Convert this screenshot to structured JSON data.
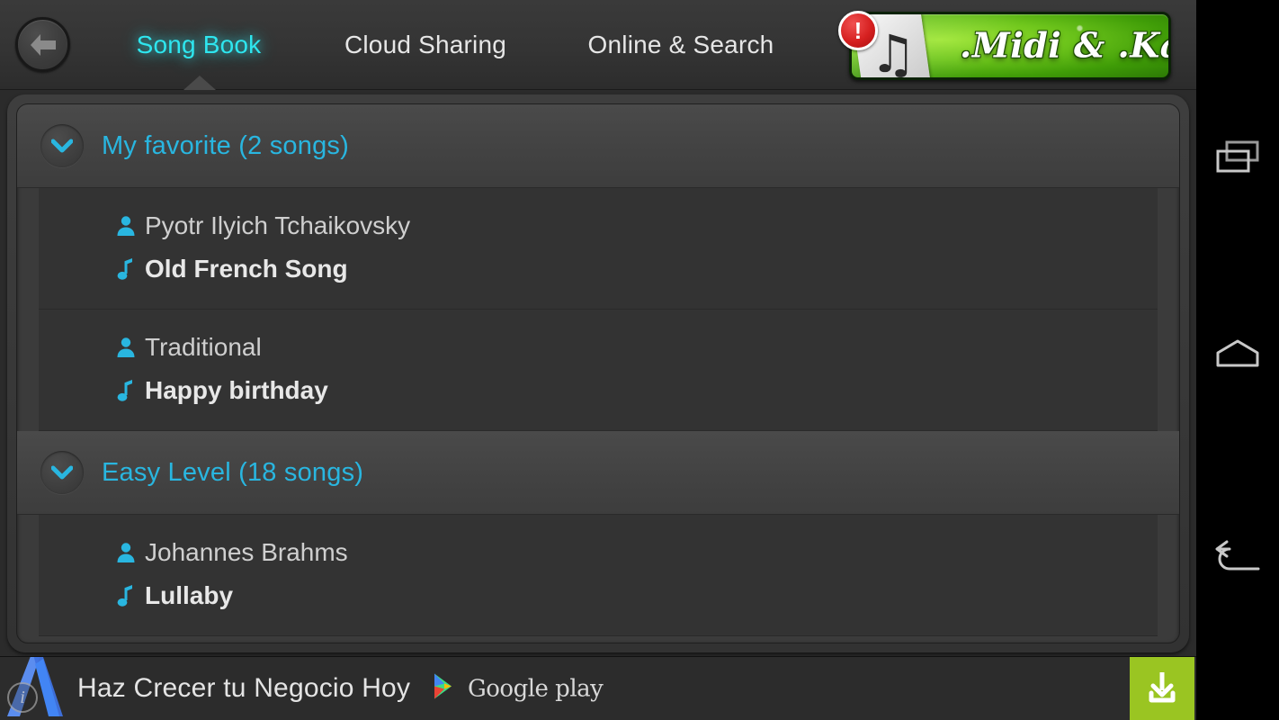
{
  "app": {
    "back_button_icon": "arrow-left-icon",
    "tabs": [
      {
        "label": "Song Book",
        "active": true
      },
      {
        "label": "Cloud Sharing",
        "active": false
      },
      {
        "label": "Online & Search",
        "active": false
      }
    ],
    "brand": {
      "name": ".Midi & .Kar",
      "badge": "!",
      "note_glyph": "♫",
      "colors": {
        "green_light": "#9ee634",
        "green_dark": "#2c7a05",
        "badge_red": "#d62020"
      }
    },
    "accent_color": "#29b6e0",
    "active_tab_color": "#2ee6ef"
  },
  "library": {
    "groups": [
      {
        "title": "My favorite (2 songs)",
        "expanded": true,
        "chevron_icon": "chevron-down-icon",
        "songs": [
          {
            "artist": "Pyotr Ilyich Tchaikovsky",
            "title": "Old French Song"
          },
          {
            "artist": "Traditional",
            "title": "Happy birthday"
          }
        ]
      },
      {
        "title": "Easy Level (18 songs)",
        "expanded": true,
        "chevron_icon": "chevron-down-icon",
        "songs": [
          {
            "artist": "Johannes Brahms",
            "title": "Lullaby"
          }
        ]
      }
    ],
    "artist_icon": "person-icon",
    "song_icon": "music-note-icon"
  },
  "ad": {
    "headline": "Haz Crecer tu Negocio Hoy",
    "store_label": "Google play",
    "info_badge": "i",
    "advertiser_icon": "google-ads-icon",
    "store_icon": "google-play-icon",
    "cta_icon": "download-icon",
    "cta_color": "#9ac522"
  },
  "navbar": {
    "buttons": [
      {
        "name": "recents",
        "icon": "recents-icon"
      },
      {
        "name": "home",
        "icon": "home-icon"
      },
      {
        "name": "back",
        "icon": "back-arrow-icon"
      }
    ]
  }
}
